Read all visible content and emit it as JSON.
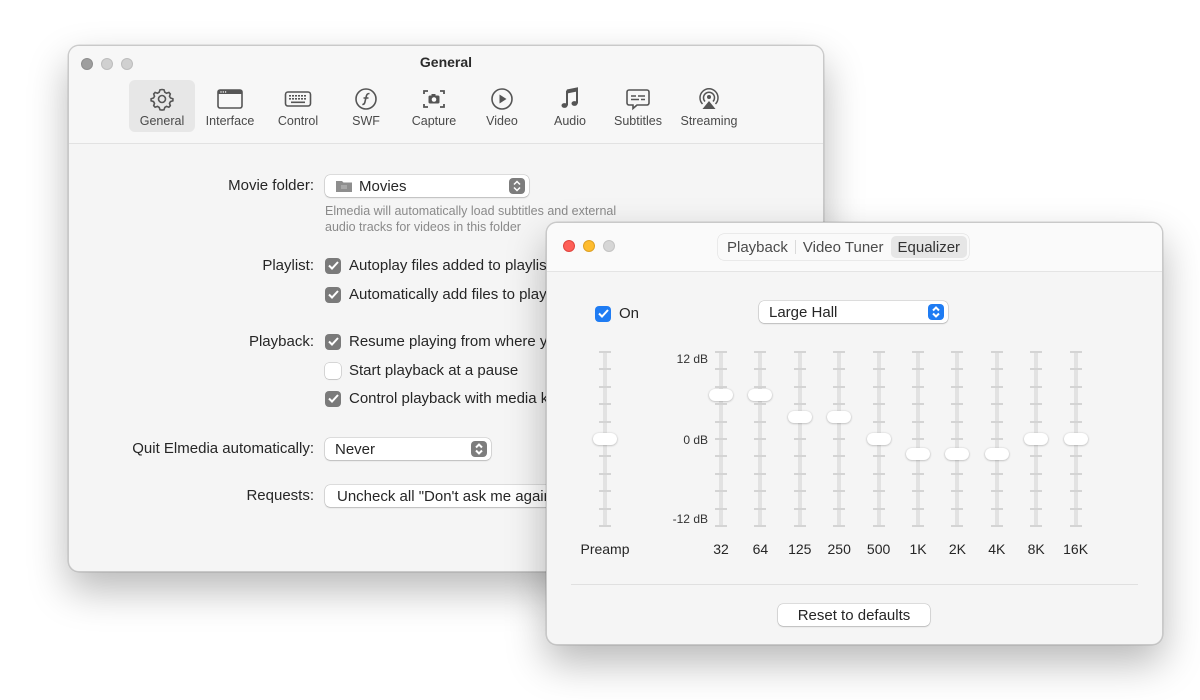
{
  "prefs": {
    "title": "General",
    "toolbar": [
      {
        "label": "General",
        "icon": "gear-icon",
        "selected": true
      },
      {
        "label": "Interface",
        "icon": "window-icon",
        "selected": false
      },
      {
        "label": "Control",
        "icon": "keyboard-icon",
        "selected": false
      },
      {
        "label": "SWF",
        "icon": "flash-icon",
        "selected": false
      },
      {
        "label": "Capture",
        "icon": "camera-icon",
        "selected": false
      },
      {
        "label": "Video",
        "icon": "play-circle-icon",
        "selected": false
      },
      {
        "label": "Audio",
        "icon": "music-note-icon",
        "selected": false
      },
      {
        "label": "Subtitles",
        "icon": "subtitles-bubble-icon",
        "selected": false
      },
      {
        "label": "Streaming",
        "icon": "airplay-icon",
        "selected": false
      }
    ],
    "movie_folder": {
      "label": "Movie folder:",
      "value": "Movies",
      "help": [
        "Elmedia will automatically load subtitles and external",
        "audio tracks for videos in this folder"
      ]
    },
    "playlist": {
      "label": "Playlist:",
      "options": [
        {
          "text": "Autoplay files added to playlist",
          "checked": true
        },
        {
          "text": "Automatically add files to playlist",
          "checked": true
        }
      ]
    },
    "playback": {
      "label": "Playback:",
      "options": [
        {
          "text": "Resume playing from where you left off",
          "checked": true
        },
        {
          "text": "Start playback at a pause",
          "checked": false
        },
        {
          "text": "Control playback with media keys",
          "checked": true
        }
      ]
    },
    "quit": {
      "label": "Quit Elmedia automatically:",
      "value": "Never"
    },
    "requests": {
      "label": "Requests:",
      "button": "Uncheck all \"Don't ask me again\""
    }
  },
  "eq": {
    "tabs": [
      {
        "label": "Playback",
        "selected": false
      },
      {
        "label": "Video Tuner",
        "selected": false
      },
      {
        "label": "Equalizer",
        "selected": true
      }
    ],
    "on_label": "On",
    "on_checked": true,
    "preset": "Large Hall",
    "db_labels": {
      "top": "12 dB",
      "mid": "0 dB",
      "bottom": "-12 dB"
    },
    "range_db": [
      -12,
      12
    ],
    "preamp": {
      "label": "Preamp",
      "value_db": 0
    },
    "bands": [
      {
        "label": "32",
        "value_db": 6
      },
      {
        "label": "64",
        "value_db": 6
      },
      {
        "label": "125",
        "value_db": 3
      },
      {
        "label": "250",
        "value_db": 3
      },
      {
        "label": "500",
        "value_db": 0
      },
      {
        "label": "1K",
        "value_db": -2
      },
      {
        "label": "2K",
        "value_db": -2
      },
      {
        "label": "4K",
        "value_db": -2
      },
      {
        "label": "8K",
        "value_db": 0
      },
      {
        "label": "16K",
        "value_db": 0
      }
    ],
    "reset_label": "Reset to defaults"
  }
}
